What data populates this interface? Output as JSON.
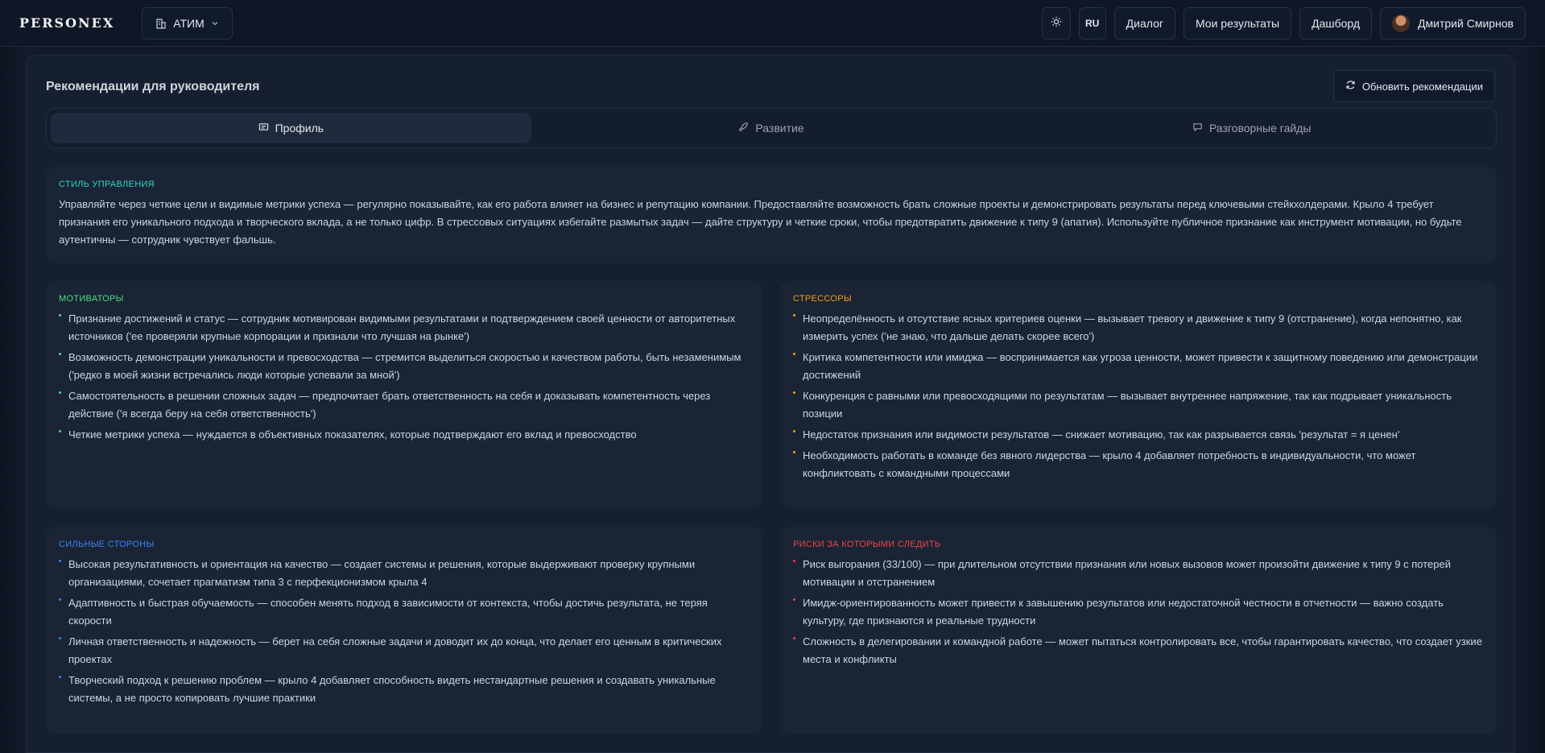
{
  "header": {
    "logo": "PERSONEX",
    "org": "АТИМ",
    "lang": "RU",
    "nav": [
      "Диалог",
      "Мои результаты",
      "Дашборд"
    ],
    "user_name": "Дмитрий Смирнов"
  },
  "page": {
    "title": "Рекомендации для руководителя",
    "refresh_label": "Обновить рекомендации",
    "tabs": [
      {
        "label": "Профиль",
        "icon": "profile-card-icon",
        "active": true
      },
      {
        "label": "Развитие",
        "icon": "rocket-icon",
        "active": false
      },
      {
        "label": "Разговорные гайды",
        "icon": "chat-icon",
        "active": false
      }
    ]
  },
  "management_style": {
    "heading": "СТИЛЬ УПРАВЛЕНИЯ",
    "text": "Управляйте через четкие цели и видимые метрики успеха — регулярно показывайте, как его работа влияет на бизнес и репутацию компании. Предоставляйте возможность брать сложные проекты и демонстрировать результаты перед ключевыми стейкхолдерами. Крыло 4 требует признания его уникального подхода и творческого вклада, а не только цифр. В стрессовых ситуациях избегайте размытых задач — дайте структуру и четкие сроки, чтобы предотвратить движение к типу 9 (апатия). Используйте публичное признание как инструмент мотивации, но будьте аутентичны — сотрудник чувствует фальшь."
  },
  "motivators": {
    "heading": "МОТИВАТОРЫ",
    "items": [
      "Признание достижений и статус — сотрудник мотивирован видимыми результатами и подтверждением своей ценности от авторитетных источников ('ее проверяли крупные корпорации и признали что лучшая на рынке')",
      "Возможность демонстрации уникальности и превосходства — стремится выделиться скоростью и качеством работы, быть незаменимым ('редко в моей жизни встречались люди которые успевали за мной')",
      "Самостоятельность в решении сложных задач — предпочитает брать ответственность на себя и доказывать компетентность через действие ('я всегда беру на себя ответственность')",
      "Четкие метрики успеха — нуждается в объективных показателях, которые подтверждают его вклад и превосходство"
    ]
  },
  "stressors": {
    "heading": "СТРЕССОРЫ",
    "items": [
      "Неопределённость и отсутствие ясных критериев оценки — вызывает тревогу и движение к типу 9 (отстранение), когда непонятно, как измерить успех ('не знаю, что дальше делать скорее всего')",
      "Критика компетентности или имиджа — воспринимается как угроза ценности, может привести к защитному поведению или демонстрации достижений",
      "Конкуренция с равными или превосходящими по результатам — вызывает внутреннее напряжение, так как подрывает уникальность позиции",
      "Недостаток признания или видимости результатов — снижает мотивацию, так как разрывается связь 'результат = я ценен'",
      "Необходимость работать в команде без явного лидерства — крыло 4 добавляет потребность в индивидуальности, что может конфликтовать с командными процессами"
    ]
  },
  "strengths": {
    "heading": "СИЛЬНЫЕ СТОРОНЫ",
    "items": [
      "Высокая результативность и ориентация на качество — создает системы и решения, которые выдерживают проверку крупными организациями, сочетает прагматизм типа 3 с перфекционизмом крыла 4",
      "Адаптивность и быстрая обучаемость — способен менять подход в зависимости от контекста, чтобы достичь результата, не теряя скорости",
      "Личная ответственность и надежность — берет на себя сложные задачи и доводит их до конца, что делает его ценным в критических проектах",
      "Творческий подход к решению проблем — крыло 4 добавляет способность видеть нестандартные решения и создавать уникальные системы, а не просто копировать лучшие практики"
    ]
  },
  "risks": {
    "heading": "РИСКИ ЗА КОТОРЫМИ СЛЕДИТЬ",
    "items": [
      "Риск выгорания (33/100) — при длительном отсутствии признания или новых вызовов может произойти движение к типу 9 с потерей мотивации и отстранением",
      "Имидж-ориентированность может привести к завышению результатов или недостаточной честности в отчетности — важно создать культуру, где признаются и реальные трудности",
      "Сложность в делегировании и командной работе — может пытаться контролировать все, чтобы гарантировать качество, что создает узкие места и конфликты"
    ]
  },
  "colors": {
    "style": "#2dd4bf",
    "motivators": "#4ade80",
    "stressors": "#f59e0b",
    "strengths": "#3b82f6",
    "risks": "#ef4444"
  }
}
